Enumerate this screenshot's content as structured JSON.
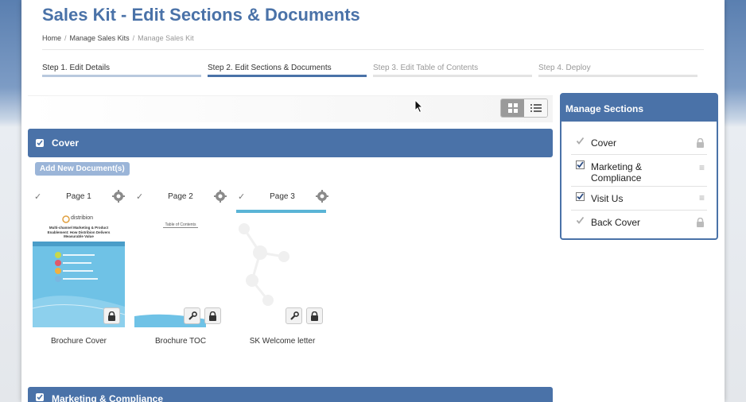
{
  "header": {
    "title": "Sales Kit - Edit Sections & Documents",
    "breadcrumb": [
      "Home",
      "Manage Sales Kits",
      "Manage Sales Kit"
    ]
  },
  "steps": [
    {
      "label": "Step 1. Edit Details",
      "state": "done"
    },
    {
      "label": "Step 2. Edit Sections & Documents",
      "state": "active"
    },
    {
      "label": "Step 3. Edit Table of Contents",
      "state": "todo"
    },
    {
      "label": "Step 4. Deploy",
      "state": "todo"
    }
  ],
  "view_toggle": {
    "active": "grid-icon",
    "icons": [
      "grid-icon",
      "list-icon"
    ]
  },
  "sections": [
    {
      "title": "Cover",
      "checked": true
    },
    {
      "title": "Marketing & Compliance",
      "checked": true
    }
  ],
  "add_document_label": "Add New Document(s)",
  "documents": [
    {
      "page": "Page 1",
      "name": "Brochure Cover",
      "selected": false,
      "actions": [
        "lock-icon"
      ]
    },
    {
      "page": "Page 2",
      "name": "Brochure TOC",
      "selected": false,
      "actions": [
        "wrench-icon",
        "lock-icon"
      ]
    },
    {
      "page": "Page 3",
      "name": "SK Welcome letter",
      "selected": true,
      "actions": [
        "wrench-icon",
        "lock-icon"
      ]
    }
  ],
  "thumbnails": {
    "brochure_logo": "distribion",
    "brochure_headline": "Multi-channel Marketing & Product Enablement: How Distribion Delivers Measurable Value",
    "toc_title": "Table of Contents"
  },
  "manage_sections": {
    "title": "Manage Sections",
    "items": [
      {
        "label": "Cover",
        "checked": true,
        "locked": true
      },
      {
        "label": "Marketing & Compliance",
        "checked": true,
        "locked": false
      },
      {
        "label": "Visit Us",
        "checked": true,
        "locked": false
      },
      {
        "label": "Back Cover",
        "checked": true,
        "locked": true
      }
    ]
  },
  "colors": {
    "brand": "#4a72a8",
    "accent": "#5ab4d6",
    "button": "#9bb5d8"
  }
}
